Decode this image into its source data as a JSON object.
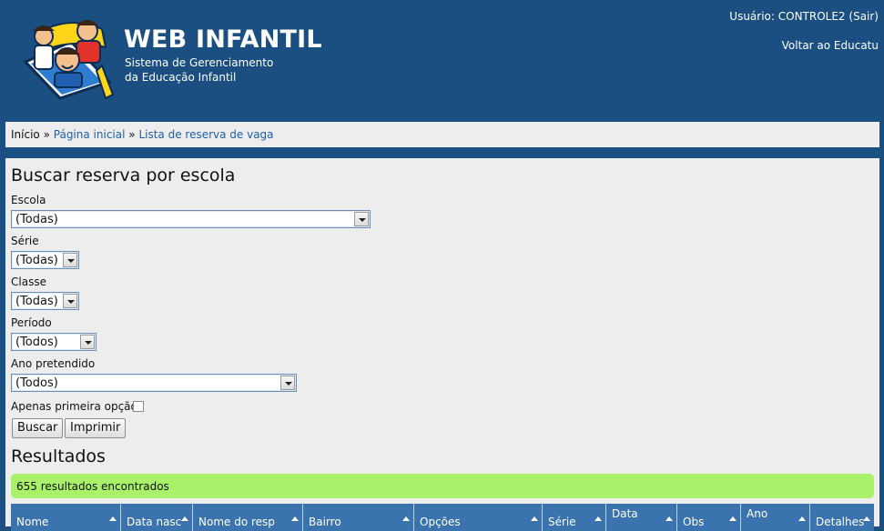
{
  "header": {
    "title": "WEB INFANTIL",
    "subtitle_line1": "Sistema de Gerenciamento",
    "subtitle_line2": "da Educação Infantil",
    "user_label": "Usuário: CONTROLE2",
    "logout_label": "(Sair)",
    "back_label": "Voltar ao Educatu"
  },
  "breadcrumb": {
    "home": "Início",
    "sep": "»",
    "items": [
      "Página inicial",
      "Lista de reserva de vaga"
    ]
  },
  "search": {
    "title": "Buscar reserva por escola",
    "fields": [
      {
        "label": "Escola",
        "value": "(Todas)"
      },
      {
        "label": "Série",
        "value": "(Todas)"
      },
      {
        "label": "Classe",
        "value": "(Todas)"
      },
      {
        "label": "Período",
        "value": "(Todos)"
      },
      {
        "label": "Ano pretendido",
        "value": "(Todos)"
      }
    ],
    "first_option_label": "Apenas primeira opção?",
    "buttons": {
      "search": "Buscar",
      "print": "Imprimir"
    }
  },
  "results": {
    "title": "Resultados",
    "count_text": "655 resultados encontrados",
    "columns": [
      "Nome",
      "Data nasc",
      "Nome do resp",
      "Bairro",
      "Opções",
      "Série",
      "Data",
      "Obs",
      "Ano",
      "Detalhes"
    ]
  },
  "colors": {
    "header_bg": "#1b4f81",
    "panel_bg": "#ededed",
    "link": "#1f5ea8",
    "count_bg": "#a8f168",
    "table_header_bg": "#3a73ad"
  }
}
